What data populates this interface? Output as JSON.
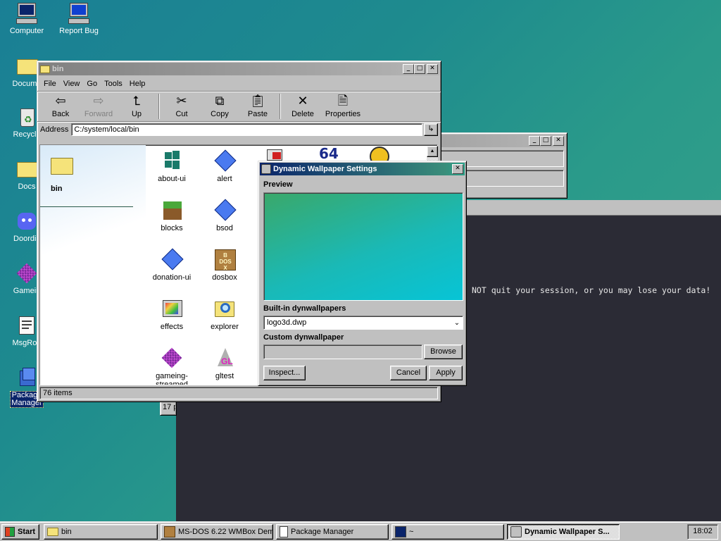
{
  "desktop": {
    "icons": [
      {
        "label": "Computer"
      },
      {
        "label": "Report Bug"
      },
      {
        "label": "Docume"
      },
      {
        "label": "Recycle"
      },
      {
        "label": "Docs"
      },
      {
        "label": "Doordis"
      },
      {
        "label": "Gamein"
      },
      {
        "label": "MsgRoo"
      },
      {
        "label": "Package\nManager"
      }
    ]
  },
  "explorer": {
    "title": "bin",
    "menu": [
      "File",
      "View",
      "Go",
      "Tools",
      "Help"
    ],
    "toolbar": {
      "back": "Back",
      "forward": "Forward",
      "up": "Up",
      "cut": "Cut",
      "copy": "Copy",
      "paste": "Paste",
      "delete": "Delete",
      "properties": "Properties"
    },
    "address_label": "Address",
    "address_value": "C:/system/local/bin",
    "folder_name": "bin",
    "files": [
      {
        "name": "about-ui"
      },
      {
        "name": "alert"
      },
      {
        "name": "blocks"
      },
      {
        "name": "bsod"
      },
      {
        "name": "donation-ui"
      },
      {
        "name": "dosbox"
      },
      {
        "name": "effects"
      },
      {
        "name": "explorer"
      },
      {
        "name": "gameing-\nstreamed"
      },
      {
        "name": "gltest"
      }
    ],
    "partial_icon_text": "64",
    "status": "76 items"
  },
  "behind_window": {
    "partial_status": "17 p"
  },
  "terminal": {
    "line": "NOT quit your session, or you may lose your data!"
  },
  "dialog": {
    "title": "Dynamic Wallpaper Settings",
    "preview_label": "Preview",
    "builtin_label": "Built-in dynwallpapers",
    "builtin_selected": "logo3d.dwp",
    "custom_label": "Custom dynwallpaper",
    "custom_value": "",
    "browse": "Browse",
    "inspect": "Inspect...",
    "cancel": "Cancel",
    "apply": "Apply",
    "preview_colors": [
      "#3aa86a",
      "#1ab9b6",
      "#07c4d6"
    ]
  },
  "taskbar": {
    "start": "Start",
    "tasks": [
      {
        "label": "bin"
      },
      {
        "label": "MS-DOS 6.22 WMBox Dem..."
      },
      {
        "label": "Package Manager"
      },
      {
        "label": "~"
      },
      {
        "label": "Dynamic Wallpaper S..."
      }
    ],
    "clock": "18:02"
  }
}
